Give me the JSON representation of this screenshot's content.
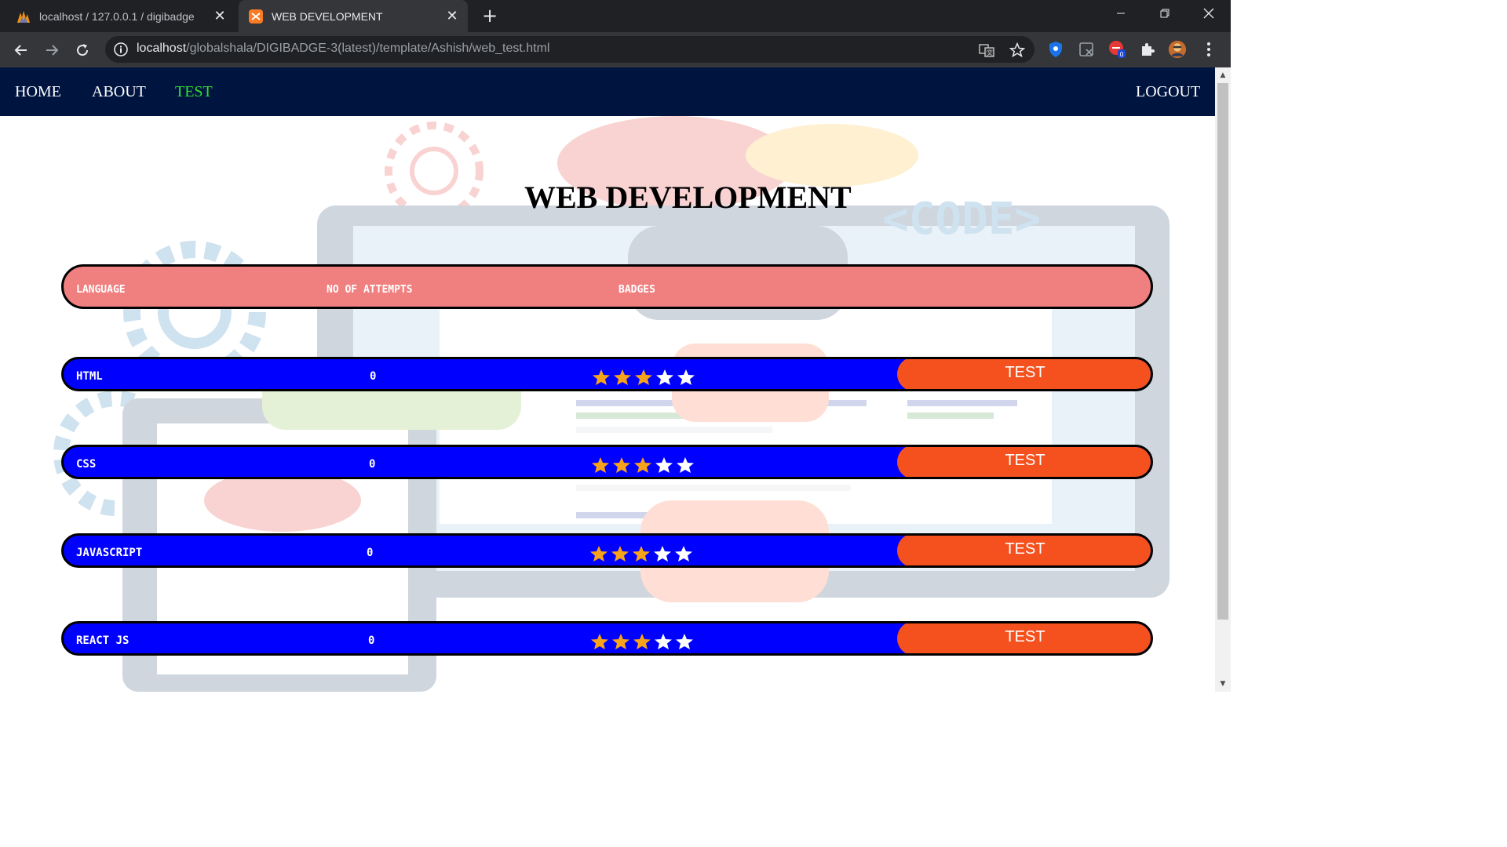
{
  "browser": {
    "tabs": [
      {
        "title": "localhost / 127.0.0.1 / digibadge",
        "active": false
      },
      {
        "title": "WEB DEVELOPMENT",
        "active": true
      }
    ],
    "url_host": "localhost",
    "url_path": "/globalshala/DIGIBADGE-3(latest)/template/Ashish/web_test.html",
    "extension_badge": "0"
  },
  "nav": {
    "home": "HOME",
    "about": "ABOUT",
    "test": "TEST",
    "logout": "LOGOUT"
  },
  "page": {
    "title": "WEB DEVELOPMENT"
  },
  "table": {
    "headers": [
      "LANGUAGE",
      "NO OF ATTEMPTS",
      "BADGES"
    ],
    "rows": [
      {
        "language": "HTML",
        "attempts": "0",
        "badges_earned": 3,
        "badges_total": 5,
        "action": "TEST"
      },
      {
        "language": "CSS",
        "attempts": "0",
        "badges_earned": 3,
        "badges_total": 5,
        "action": "TEST"
      },
      {
        "language": "JAVASCRIPT",
        "attempts": "0",
        "badges_earned": 3,
        "badges_total": 5,
        "action": "TEST"
      },
      {
        "language": "REACT JS",
        "attempts": "0",
        "badges_earned": 3,
        "badges_total": 5,
        "action": "TEST"
      }
    ]
  },
  "colors": {
    "navbar": "#001440",
    "nav_active": "#33dd33",
    "header_row": "#f08080",
    "row": "#0000ff",
    "test_button": "#f4511e",
    "star_filled": "#f7a21b",
    "star_empty": "#ffffff"
  }
}
